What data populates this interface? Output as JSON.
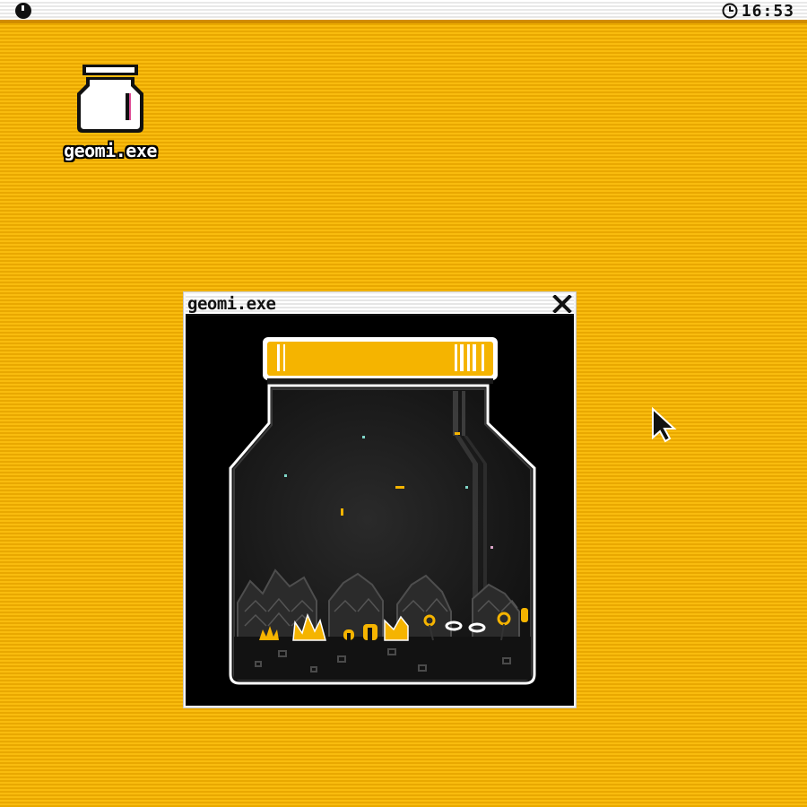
{
  "menubar": {
    "logo_icon": "circle-logo-icon",
    "clock_icon": "clock-icon",
    "time": "16:53"
  },
  "desktop": {
    "icons": [
      {
        "label": "geomi.exe",
        "icon": "jar-icon"
      }
    ]
  },
  "window": {
    "title": "geomi.exe",
    "close_icon": "close-x-icon",
    "content": "jar-terrarium-scene"
  },
  "colors": {
    "desktop_yellow": "#f7b500",
    "accent_orange": "#f5b400",
    "window_black": "#000000",
    "chrome_white": "#ffffff"
  }
}
